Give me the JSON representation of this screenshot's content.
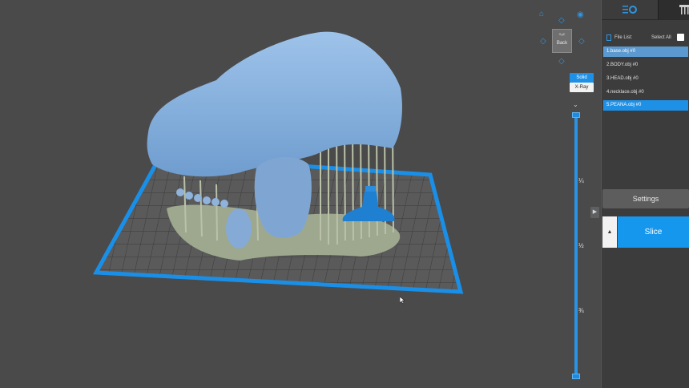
{
  "app": {
    "accent": "#1e90e6"
  },
  "viewport": {
    "viewcube_face": "Back",
    "viewcube_top": "ЯдЕ",
    "mode_solid": "Solid",
    "mode_xray": "X-Ray",
    "slider_ticks": [
      "¼",
      "½",
      "¾"
    ],
    "icons": {
      "home": "home-icon",
      "eye": "eye-icon",
      "rotate_up": "rotate-up-icon",
      "rotate_down": "rotate-down-icon",
      "rotate_left": "rotate-left-icon",
      "rotate_right": "rotate-right-icon",
      "collapse": "chevron-down-icon"
    }
  },
  "sidebar": {
    "file_list_label": "File List:",
    "select_all_label": "Select All",
    "files": [
      {
        "name": "1.base.obj #0",
        "state": "selected-light"
      },
      {
        "name": "2.BODY.obj #0",
        "state": "normal"
      },
      {
        "name": "3.HEAD.obj #0",
        "state": "normal"
      },
      {
        "name": "4.necklace.obj #0",
        "state": "normal"
      },
      {
        "name": "5.PEANA.obj #0",
        "state": "selected"
      }
    ],
    "settings_label": "Settings",
    "slice_label": "Slice",
    "arrow_label": "▲",
    "expand_label": "▶"
  }
}
